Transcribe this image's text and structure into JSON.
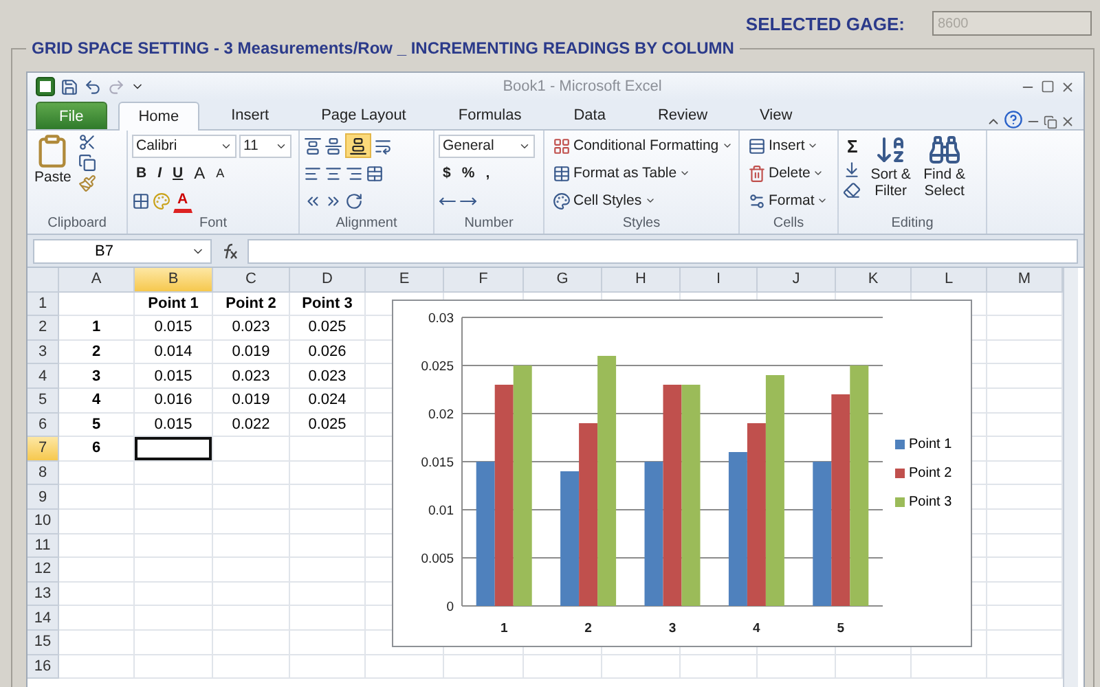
{
  "gage": {
    "label": "SELECTED GAGE:",
    "value": "8600",
    "disabled": true
  },
  "group": {
    "title": "GRID SPACE SETTING - 3 Measurements/Row _ INCREMENTING READINGS BY COLUMN"
  },
  "excel": {
    "title": "Book1 - Microsoft Excel",
    "tabs": [
      {
        "label": "File",
        "kind": "file",
        "selected": false
      },
      {
        "label": "Home",
        "kind": "tab",
        "selected": true
      },
      {
        "label": "Insert",
        "kind": "tab",
        "selected": false
      },
      {
        "label": "Page Layout",
        "kind": "tab",
        "selected": false
      },
      {
        "label": "Formulas",
        "kind": "tab",
        "selected": false
      },
      {
        "label": "Data",
        "kind": "tab",
        "selected": false
      },
      {
        "label": "Review",
        "kind": "tab",
        "selected": false
      },
      {
        "label": "View",
        "kind": "tab",
        "selected": false
      }
    ],
    "ribbon": {
      "clipboard": {
        "label": "Clipboard",
        "paste": "Paste"
      },
      "font": {
        "label": "Font",
        "font_name": "Calibri",
        "font_size": "11",
        "styles": [
          "B",
          "I",
          "U"
        ],
        "grow": "A",
        "shrink": "A",
        "font_color_letter": "A"
      },
      "alignment": {
        "label": "Alignment"
      },
      "number": {
        "label": "Number",
        "format": "General",
        "currency": "$",
        "percent": "%",
        "comma": ","
      },
      "styles": {
        "label": "Styles",
        "items": [
          "Conditional Formatting",
          "Format as Table",
          "Cell Styles"
        ]
      },
      "cells": {
        "label": "Cells",
        "items": [
          "Insert",
          "Delete",
          "Format"
        ]
      },
      "editing": {
        "label": "Editing",
        "sum": "Σ",
        "items": [
          "Sort & Filter",
          "Find & Select"
        ]
      }
    },
    "formula_bar": {
      "name_box": "B7"
    },
    "sheet": {
      "columns": [
        {
          "label": "A",
          "selected": false
        },
        {
          "label": "B",
          "selected": true
        },
        {
          "label": "C",
          "selected": false
        },
        {
          "label": "D",
          "selected": false
        },
        {
          "label": "E",
          "selected": false
        },
        {
          "label": "F",
          "selected": false
        },
        {
          "label": "G",
          "selected": false
        },
        {
          "label": "H",
          "selected": false
        },
        {
          "label": "I",
          "selected": false
        },
        {
          "label": "J",
          "selected": false
        },
        {
          "label": "K",
          "selected": false
        },
        {
          "label": "L",
          "selected": false
        },
        {
          "label": "M",
          "selected": false
        }
      ],
      "rows": [
        {
          "header": "1",
          "selected": false,
          "cells": {
            "B": "Point 1",
            "C": "Point 2",
            "D": "Point 3"
          }
        },
        {
          "header": "2",
          "selected": false,
          "cells": {
            "A": "1",
            "B": "0.015",
            "C": "0.023",
            "D": "0.025"
          }
        },
        {
          "header": "3",
          "selected": false,
          "cells": {
            "A": "2",
            "B": "0.014",
            "C": "0.019",
            "D": "0.026"
          }
        },
        {
          "header": "4",
          "selected": false,
          "cells": {
            "A": "3",
            "B": "0.015",
            "C": "0.023",
            "D": "0.023"
          }
        },
        {
          "header": "5",
          "selected": false,
          "cells": {
            "A": "4",
            "B": "0.016",
            "C": "0.019",
            "D": "0.024"
          }
        },
        {
          "header": "6",
          "selected": false,
          "cells": {
            "A": "5",
            "B": "0.015",
            "C": "0.022",
            "D": "0.025"
          }
        },
        {
          "header": "7",
          "selected": true,
          "cells": {
            "A": "6"
          }
        },
        {
          "header": "8",
          "selected": false,
          "cells": {}
        },
        {
          "header": "9",
          "selected": false,
          "cells": {}
        },
        {
          "header": "10",
          "selected": false,
          "cells": {}
        },
        {
          "header": "11",
          "selected": false,
          "cells": {}
        },
        {
          "header": "12",
          "selected": false,
          "cells": {}
        },
        {
          "header": "13",
          "selected": false,
          "cells": {}
        },
        {
          "header": "14",
          "selected": false,
          "cells": {}
        },
        {
          "header": "15",
          "selected": false,
          "cells": {}
        },
        {
          "header": "16",
          "selected": false,
          "cells": {}
        }
      ]
    },
    "chart": {
      "chart_data": {
        "type": "bar",
        "grid": true,
        "legend": "right",
        "categories": [
          "1",
          "2",
          "3",
          "4",
          "5"
        ],
        "series": [
          {
            "name": "Point 1",
            "color": "#4f81bd",
            "values": [
              0.015,
              0.014,
              0.015,
              0.016,
              0.015
            ]
          },
          {
            "name": "Point 2",
            "color": "#c0504d",
            "values": [
              0.023,
              0.019,
              0.023,
              0.019,
              0.022
            ]
          },
          {
            "name": "Point 3",
            "color": "#9bbb59",
            "values": [
              0.025,
              0.026,
              0.023,
              0.024,
              0.025
            ]
          }
        ],
        "ylim": [
          0,
          0.03
        ],
        "yticks": [
          {
            "value": 0,
            "label": "0"
          },
          {
            "value": 0.005,
            "label": "0.005"
          },
          {
            "value": 0.01,
            "label": "0.01"
          },
          {
            "value": 0.015,
            "label": "0.015"
          },
          {
            "value": 0.02,
            "label": "0.02"
          },
          {
            "value": 0.025,
            "label": "0.025"
          },
          {
            "value": 0.03,
            "label": "0.03"
          }
        ]
      }
    }
  }
}
